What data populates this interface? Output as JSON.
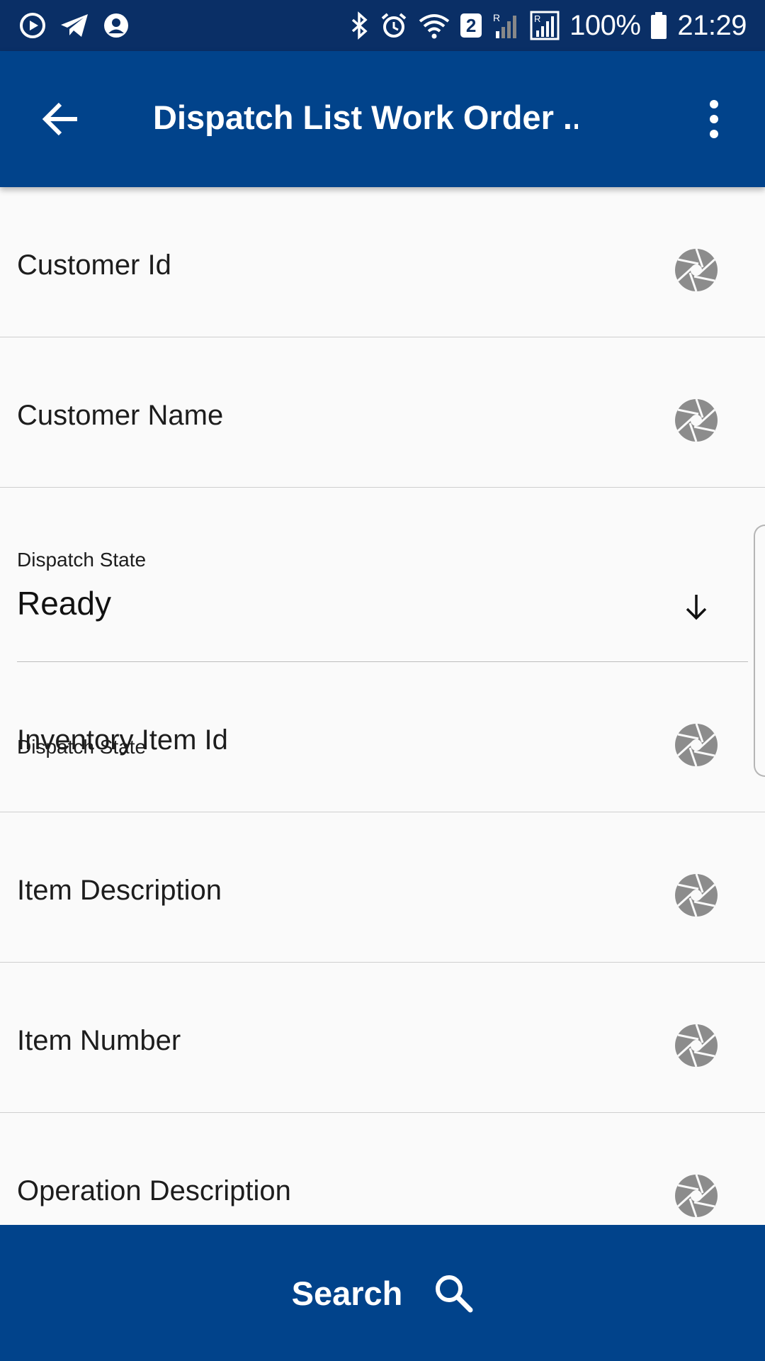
{
  "status_bar": {
    "notification_icons": [
      "play-icon",
      "telegram-icon",
      "account-icon"
    ],
    "system_icons": [
      "bluetooth-icon",
      "alarm-icon",
      "wifi-icon",
      "signal-icon",
      "signal-icon",
      "battery-icon"
    ],
    "sim_badge": "2",
    "battery_percent": "100%",
    "time": "21:29"
  },
  "app_bar": {
    "title": "Dispatch List Work Order ...",
    "back_icon": "arrow-back-icon",
    "menu_icon": "more-vert-icon",
    "color": "#01438b"
  },
  "fields": [
    {
      "label": "Customer Id",
      "icon": "aperture-icon"
    },
    {
      "label": "Customer Name",
      "icon": "aperture-icon"
    },
    {
      "label": "Inventory Item Id",
      "icon": "aperture-icon"
    },
    {
      "label": "Item Description",
      "icon": "aperture-icon"
    },
    {
      "label": "Item Number",
      "icon": "aperture-icon"
    },
    {
      "label": "Operation Description",
      "icon": "aperture-icon"
    }
  ],
  "dispatch_state": {
    "label": "Dispatch State",
    "value": "Ready",
    "icon": "arrow-down-icon"
  },
  "bottom_bar": {
    "label": "Search",
    "icon": "search-icon",
    "color": "#01438b"
  }
}
